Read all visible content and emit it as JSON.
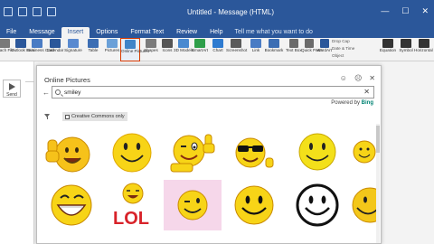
{
  "window": {
    "title": "Untitled - Message (HTML)",
    "controls": [
      "—",
      "☐",
      "✕"
    ]
  },
  "ribbon": {
    "tabs": [
      "File",
      "Message",
      "Insert",
      "Options",
      "Format Text",
      "Review",
      "Help"
    ],
    "active_tab": "Insert",
    "tell_me": "Tell me what you want to do",
    "buttons": [
      {
        "label": "Attach File",
        "icon": "paperclip-icon",
        "color": "#7a7a7a"
      },
      {
        "label": "Outlook Item",
        "icon": "outlook-item-icon",
        "color": "#2b579a"
      },
      {
        "label": "Business Card",
        "icon": "business-card-icon",
        "color": "#4a7cc4"
      },
      {
        "label": "Calendar",
        "icon": "calendar-icon",
        "color": "#2b579a"
      },
      {
        "label": "Signature",
        "icon": "signature-icon",
        "color": "#5a8ad0"
      },
      {
        "label": "Table",
        "icon": "table-icon",
        "color": "#3c6eb4"
      },
      {
        "label": "Pictures",
        "icon": "pictures-icon",
        "color": "#6aa0d8"
      },
      {
        "label": "Online Pictures",
        "icon": "online-pictures-icon",
        "color": "#3f84c8"
      },
      {
        "label": "Shapes",
        "icon": "shapes-icon",
        "color": "#7b7b7b"
      },
      {
        "label": "Icons",
        "icon": "icons-icon",
        "color": "#555555"
      },
      {
        "label": "3D Models",
        "icon": "3d-models-icon",
        "color": "#4a8ad0"
      },
      {
        "label": "SmartArt",
        "icon": "smartart-icon",
        "color": "#2e9e49"
      },
      {
        "label": "Chart",
        "icon": "chart-icon",
        "color": "#2e7bd0"
      },
      {
        "label": "Screenshot",
        "icon": "screenshot-icon",
        "color": "#5a5a5a"
      },
      {
        "label": "Link",
        "icon": "link-icon",
        "color": "#4a7cc4"
      },
      {
        "label": "Bookmark",
        "icon": "bookmark-icon",
        "color": "#3c6eb4"
      },
      {
        "label": "Text Box",
        "icon": "text-box-icon",
        "color": "#6b6b6b"
      },
      {
        "label": "Quick Parts",
        "icon": "quick-parts-icon",
        "color": "#6b6b6b"
      },
      {
        "label": "WordArt",
        "icon": "wordart-icon",
        "color": "#2b579a"
      },
      {
        "label": "Equation",
        "icon": "equation-icon",
        "color": "#333333"
      },
      {
        "label": "Symbol",
        "icon": "symbol-icon",
        "color": "#333333"
      },
      {
        "label": "Horizontal Line",
        "icon": "horizontal-line-icon",
        "color": "#333333"
      }
    ],
    "small_items": [
      "Drop Cap",
      "Date & Time",
      "Object"
    ]
  },
  "compose": {
    "send_label": "Send"
  },
  "dialog": {
    "title": "Online Pictures",
    "search_value": "smiley",
    "powered_by": "Powered by",
    "bing": "Bing",
    "filter_chip": "Creative Commons only",
    "lol_text": "LOL",
    "lol_color": "#d8232a"
  },
  "results": [
    {
      "id": "thumbs-up-smiley",
      "label": "thumbs up smiley"
    },
    {
      "id": "classic-smiley",
      "label": "classic smiley"
    },
    {
      "id": "winking-thumbs-smiley",
      "label": "winking smiley with thumbs up"
    },
    {
      "id": "sunglasses-smiley",
      "label": "smiley with sunglasses"
    },
    {
      "id": "simple-smiley",
      "label": "simple smiley"
    },
    {
      "id": "small-smiley",
      "label": "small smiley"
    },
    {
      "id": "laughing-smiley",
      "label": "laughing smiley"
    },
    {
      "id": "lol-smiley",
      "label": "LOL smiley"
    },
    {
      "id": "wink-pink-smiley",
      "label": "winking smiley on pink"
    },
    {
      "id": "happy-smiley",
      "label": "happy smiley"
    },
    {
      "id": "outline-smiley",
      "label": "outline smiley"
    },
    {
      "id": "grinning-smiley",
      "label": "grinning smiley"
    }
  ],
  "colors": {
    "accent": "#2b579a",
    "highlight_border": "#d83b01",
    "smiley_yellow": "#f7d417"
  }
}
